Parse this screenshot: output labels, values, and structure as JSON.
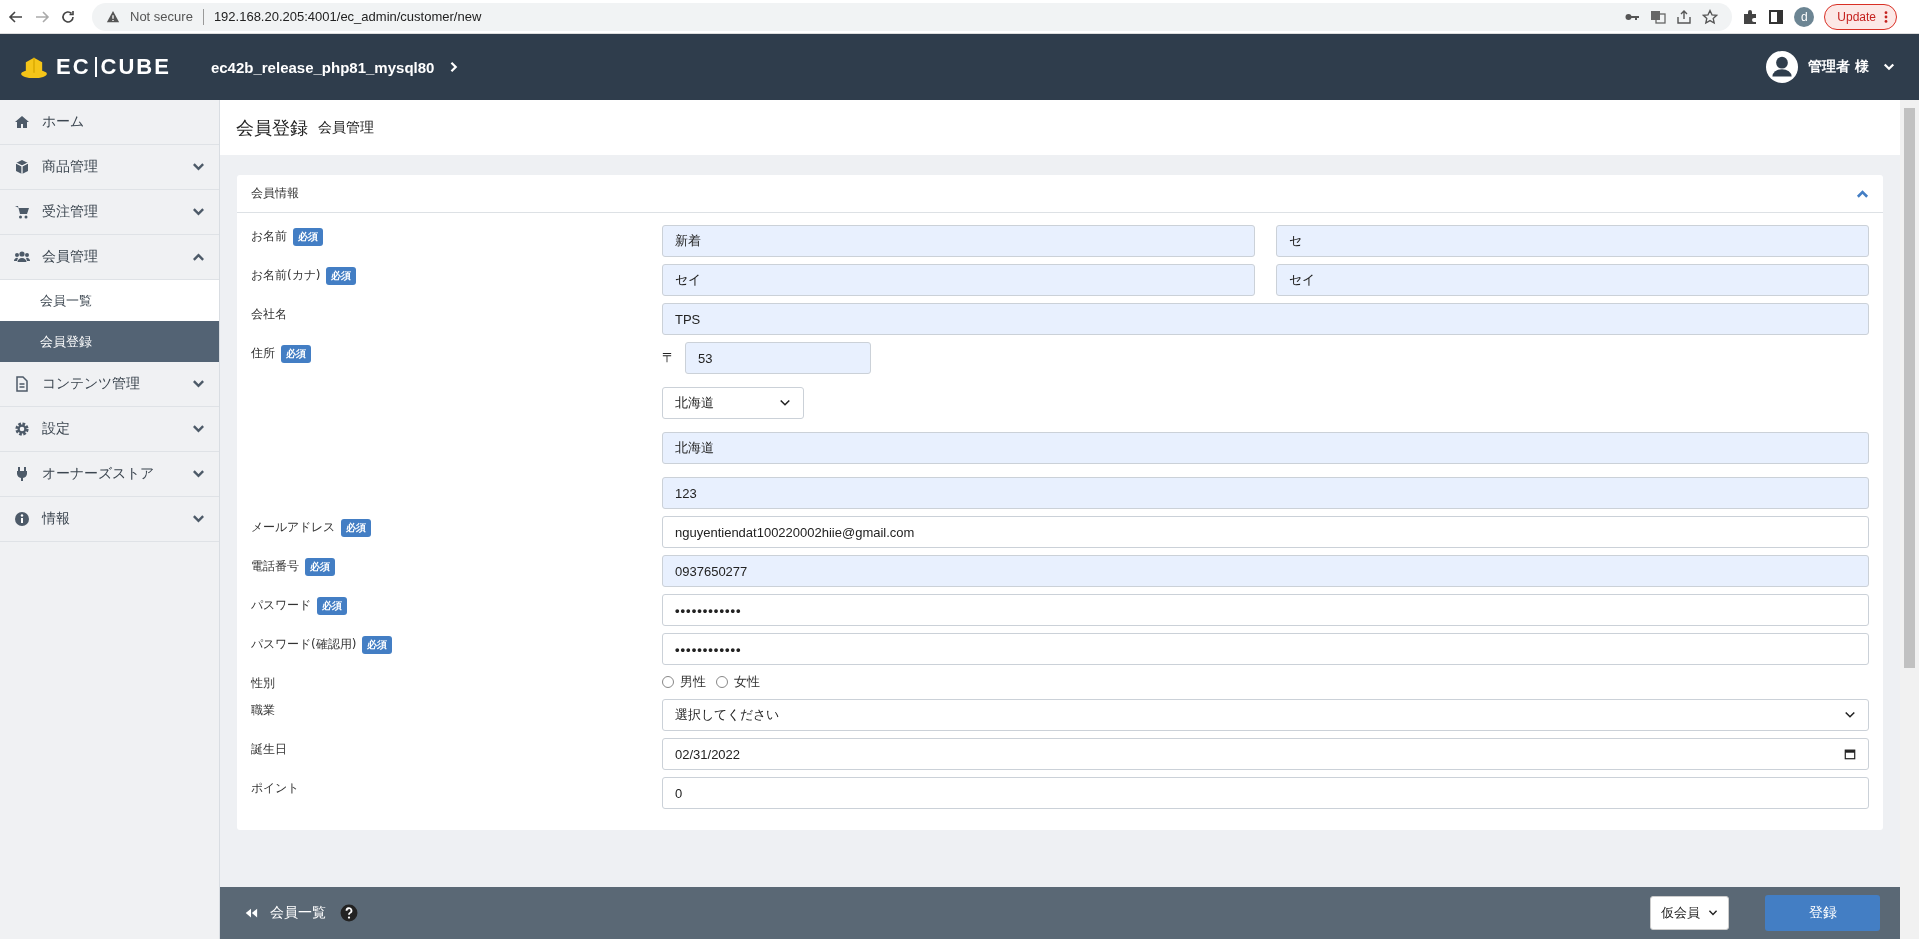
{
  "browser": {
    "security": "Not secure",
    "url": "192.168.20.205:4001/ec_admin/customer/new",
    "profile": "d",
    "update_button": "Update"
  },
  "header": {
    "logo": [
      "EC",
      "CUBE"
    ],
    "shop_name": "ec42b_release_php81_mysql80",
    "user": "管理者 様"
  },
  "sidebar": {
    "items": [
      {
        "kind": "link",
        "label": "ホーム"
      },
      {
        "kind": "menu",
        "label": "商品管理",
        "expanded": false
      },
      {
        "kind": "menu",
        "label": "受注管理",
        "expanded": false
      },
      {
        "kind": "menu",
        "label": "会員管理",
        "expanded": true,
        "children": [
          {
            "label": "会員一覧",
            "selected": false
          },
          {
            "label": "会員登録",
            "selected": true
          }
        ]
      },
      {
        "kind": "menu",
        "label": "コンテンツ管理",
        "expanded": false
      },
      {
        "kind": "menu",
        "label": "設定",
        "expanded": false
      },
      {
        "kind": "menu",
        "label": "オーナーズストア",
        "expanded": false
      },
      {
        "kind": "menu",
        "label": "情報",
        "expanded": false
      }
    ]
  },
  "page": {
    "title": "会員登録",
    "subtitle": "会員管理"
  },
  "card": {
    "title": "会員情報",
    "expanded": true,
    "rows": [
      {
        "label": "お名前",
        "badge": "必須",
        "fields": [
          {
            "kind": "text",
            "value": "新着",
            "autofilled": true
          },
          {
            "kind": "text",
            "value": "セ",
            "autofilled": true
          }
        ]
      },
      {
        "label": "お名前(カナ)",
        "badge": "必須",
        "fields": [
          {
            "kind": "text",
            "value": "セイ",
            "autofilled": true
          },
          {
            "kind": "text",
            "value": "セイ",
            "autofilled": true
          }
        ]
      },
      {
        "label": "会社名",
        "fields": [
          {
            "kind": "text",
            "value": "TPS",
            "autofilled": true
          }
        ]
      },
      {
        "label": "住所",
        "badge": "必須",
        "fields": [
          {
            "kind": "postal",
            "prefix": "〒",
            "value": "53",
            "autofilled": true
          },
          {
            "kind": "select",
            "value": "北海道",
            "autofilled": false
          },
          {
            "kind": "text",
            "value": "北海道",
            "autofilled": true
          },
          {
            "kind": "text",
            "value": "123",
            "autofilled": true
          }
        ]
      },
      {
        "label": "メールアドレス",
        "badge": "必須",
        "fields": [
          {
            "kind": "text",
            "value": "nguyentiendat100220002hiie@gmail.com",
            "autofilled": false
          }
        ]
      },
      {
        "label": "電話番号",
        "badge": "必須",
        "fields": [
          {
            "kind": "text",
            "value": "0937650277",
            "autofilled": true
          }
        ]
      },
      {
        "label": "パスワード",
        "badge": "必須",
        "fields": [
          {
            "kind": "password",
            "value": "••••••••••••",
            "autofilled": false
          }
        ]
      },
      {
        "label": "パスワード(確認用)",
        "badge": "必須",
        "fields": [
          {
            "kind": "password",
            "value": "••••••••••••",
            "autofilled": false
          }
        ]
      },
      {
        "label": "性別",
        "fields": [
          {
            "kind": "radio",
            "options": [
              {
                "label": "男性",
                "checked": false
              },
              {
                "label": "女性",
                "checked": false
              }
            ]
          }
        ]
      },
      {
        "label": "職業",
        "fields": [
          {
            "kind": "wideselect",
            "value": "選択してください",
            "autofilled": false
          }
        ]
      },
      {
        "label": "誕生日",
        "fields": [
          {
            "kind": "date",
            "value": "02/31/2022",
            "autofilled": false
          }
        ]
      },
      {
        "label": "ポイント",
        "fields": [
          {
            "kind": "text",
            "value": "0",
            "autofilled": false
          }
        ]
      }
    ]
  },
  "footer": {
    "back_link": "会員一覧",
    "status_select": "仮会員",
    "submit_button": "登録"
  }
}
